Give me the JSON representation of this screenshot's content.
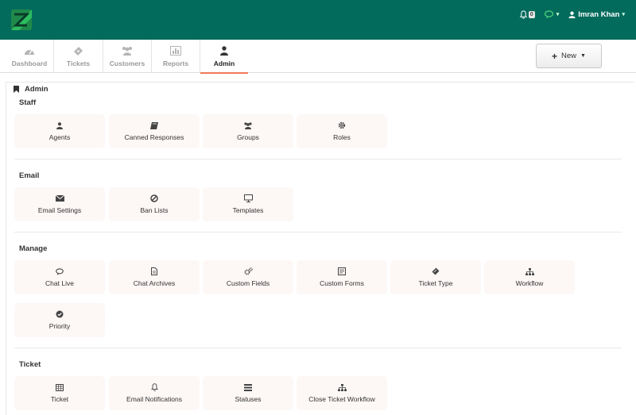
{
  "header": {
    "notification_count": "0",
    "user_name": "Imran Khan"
  },
  "tabs": [
    {
      "label": "Dashboard",
      "icon": "dashboard-icon"
    },
    {
      "label": "Tickets",
      "icon": "ticket-icon"
    },
    {
      "label": "Customers",
      "icon": "users-icon"
    },
    {
      "label": "Reports",
      "icon": "bar-chart-icon"
    },
    {
      "label": "Admin",
      "icon": "user-icon",
      "active": true
    }
  ],
  "new_button": {
    "label": "New"
  },
  "panel": {
    "title": "Admin"
  },
  "sections": {
    "staff": {
      "title": "Staff",
      "items": [
        {
          "label": "Agents",
          "icon": "user-icon"
        },
        {
          "label": "Canned Responses",
          "icon": "book-icon"
        },
        {
          "label": "Groups",
          "icon": "users-icon"
        },
        {
          "label": "Roles",
          "icon": "cog-icon"
        }
      ]
    },
    "email": {
      "title": "Email",
      "items": [
        {
          "label": "Email Settings",
          "icon": "envelope-icon"
        },
        {
          "label": "Ban Lists",
          "icon": "ban-icon"
        },
        {
          "label": "Templates",
          "icon": "monitor-icon"
        }
      ]
    },
    "manage": {
      "title": "Manage",
      "items": [
        {
          "label": "Chat Live",
          "icon": "chat-icon"
        },
        {
          "label": "Chat Archives",
          "icon": "file-icon"
        },
        {
          "label": "Custom Fields",
          "icon": "cogs-icon"
        },
        {
          "label": "Custom Forms",
          "icon": "form-icon"
        },
        {
          "label": "Ticket Type",
          "icon": "ticket-icon"
        },
        {
          "label": "Workflow",
          "icon": "sitemap-icon"
        },
        {
          "label": "Priority",
          "icon": "check-circle-icon"
        }
      ]
    },
    "ticket": {
      "title": "Ticket",
      "items": [
        {
          "label": "Ticket",
          "icon": "table-icon"
        },
        {
          "label": "Email Notifications",
          "icon": "bell-icon"
        },
        {
          "label": "Statuses",
          "icon": "list-icon"
        },
        {
          "label": "Close Ticket Workflow",
          "icon": "sitemap-icon"
        }
      ]
    }
  }
}
